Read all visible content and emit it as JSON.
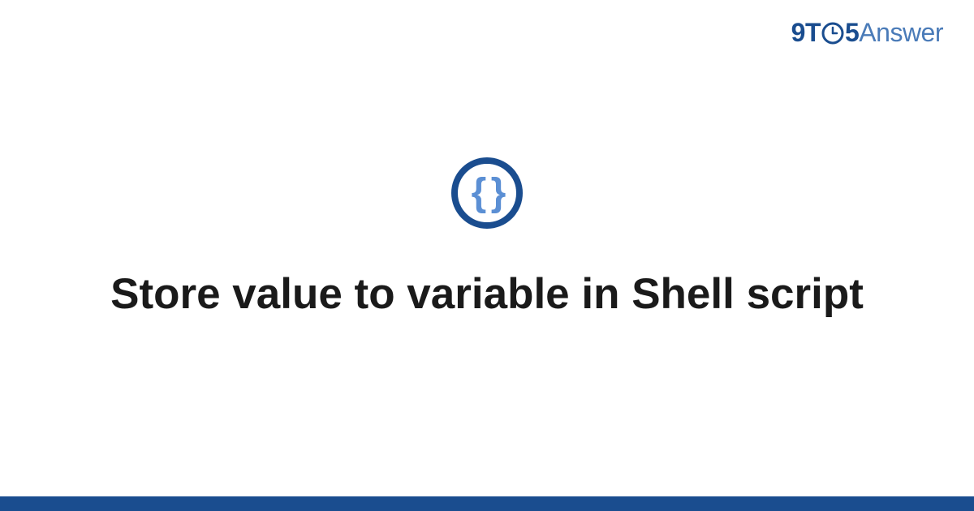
{
  "brand": {
    "part1": "9T",
    "part2": "5",
    "part3": "Answer"
  },
  "icon": {
    "name": "code-braces-icon",
    "glyph": "{ }"
  },
  "title": "Store value to variable in Shell script",
  "colors": {
    "brand_dark": "#1a4d8f",
    "brand_light": "#4a7bb8",
    "icon_inner": "#5b8fd4",
    "text": "#1a1a1a"
  }
}
